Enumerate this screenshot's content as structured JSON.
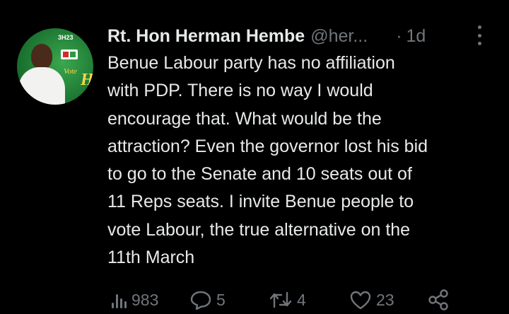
{
  "author": {
    "display_name": "Rt. Hon Herman Hembe",
    "handle": "@her...",
    "separator": "·",
    "timestamp": "1d",
    "avatar_poster": {
      "code": "3H23",
      "vote_text": "Vote",
      "letter": "H"
    }
  },
  "tweet": {
    "lines": [
      "Benue Labour party has no affiliation",
      "with PDP. There is no way I would",
      "encourage that. What would be the",
      "attraction? Even the governor lost his bid",
      "to go to the Senate and 10 seats out of",
      "11 Reps seats. I invite Benue people to",
      "vote Labour, the true alternative on the",
      "11th March"
    ]
  },
  "actions": {
    "views": {
      "icon": "views-icon",
      "count": "983"
    },
    "replies": {
      "icon": "reply-icon",
      "count": "5"
    },
    "retweets": {
      "icon": "retweet-icon",
      "count": "4"
    },
    "likes": {
      "icon": "like-icon",
      "count": "23"
    },
    "share": {
      "icon": "share-icon"
    }
  },
  "colors": {
    "background": "#000000",
    "text_primary": "#e7e9ea",
    "text_secondary": "#71767b",
    "avatar_green": "#2c9a3f"
  }
}
